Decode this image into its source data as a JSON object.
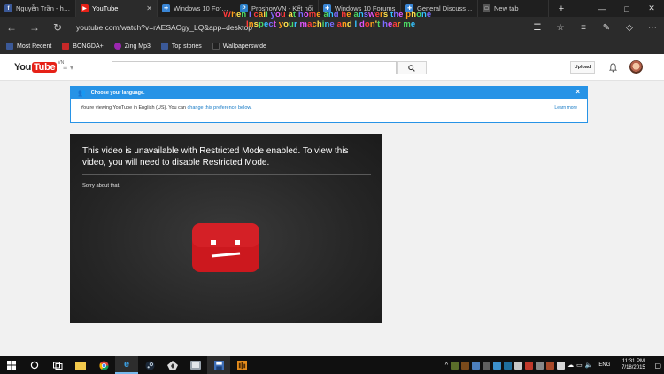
{
  "browser": {
    "tabs": [
      {
        "title": "Nguyễn Trần - huhuhl",
        "favicon": "facebook-icon",
        "color": "#3b5998",
        "glyph": "f"
      },
      {
        "title": "YouTube",
        "favicon": "youtube-icon",
        "color": "#e62117",
        "glyph": "▶",
        "active": true
      },
      {
        "title": "Windows 10 Forums",
        "favicon": "windows-icon",
        "color": "#3a86d6",
        "glyph": "✚"
      },
      {
        "title": "ProshowVN - Kết nối",
        "favicon": "proshow-icon",
        "color": "#2a7fc9",
        "glyph": "P"
      },
      {
        "title": "Windows 10 Forums",
        "favicon": "windows-icon",
        "color": "#3a86d6",
        "glyph": "✚"
      },
      {
        "title": "General Discussion - F",
        "favicon": "windows-icon",
        "color": "#3a86d6",
        "glyph": "✚"
      },
      {
        "title": "New tab",
        "favicon": "new-tab-icon",
        "color": "#555555",
        "glyph": "□"
      }
    ],
    "new_tab_button": "+",
    "window_controls": {
      "minimize": "—",
      "maximize": "□",
      "close": "✕"
    },
    "url": "youtube.com/watch?v=rAESAOgy_LQ&app=desktop",
    "overlay_lines": [
      "When I call you at home and he answers the phone",
      "Inspect your machine and I don't hear me"
    ],
    "favorites": [
      {
        "label": "Most Recent",
        "color": "#3b5998"
      },
      {
        "label": "BONGDA+",
        "color": "#c62828"
      },
      {
        "label": "Zing Mp3",
        "color": "#9c27b0"
      },
      {
        "label": "Top stories",
        "color": "#3b5998"
      },
      {
        "label": "Wallpaperswide",
        "color": "#222222"
      }
    ]
  },
  "youtube": {
    "logo_you": "You",
    "logo_tube": "Tube",
    "logo_region": "VN",
    "upload_label": "Upload",
    "language_banner": {
      "heading": "Choose your language.",
      "body_prefix": "You're viewing YouTube in English (US). You can ",
      "link": "change this preference below.",
      "learn_more": "Learn more",
      "close": "×"
    },
    "player": {
      "message": "This video is unavailable with Restricted Mode enabled. To view this video, you will need to disable Restricted Mode.",
      "sorry": "Sorry about that."
    }
  },
  "taskbar": {
    "apps": [
      "file-explorer-icon",
      "chrome-icon",
      "edge-icon",
      "steam-icon",
      "game-icon",
      "app-icon",
      "save-icon",
      "app-orange-icon"
    ],
    "language": "ENG",
    "time": "11:31 PM",
    "date": "7/18/2015"
  }
}
